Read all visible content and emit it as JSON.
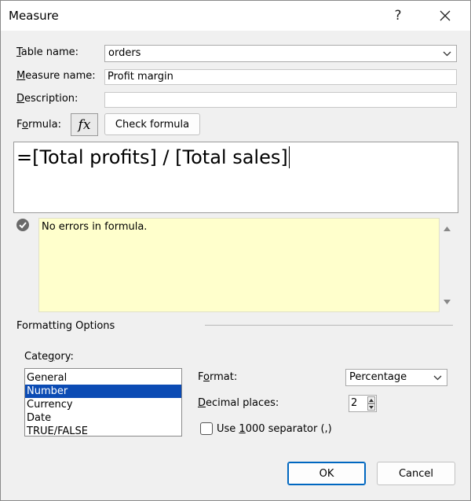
{
  "window": {
    "title": "Measure",
    "help_glyph": "?",
    "close_glyph": "✕"
  },
  "table_name": {
    "label_prefix": "",
    "label_accel": "T",
    "label_rest": "able name:",
    "value": "orders"
  },
  "measure_name": {
    "label_accel": "M",
    "label_rest": "easure name:",
    "value": "Profit margin"
  },
  "description": {
    "label_accel": "D",
    "label_rest": "escription:",
    "value": ""
  },
  "formula": {
    "label_pre": "F",
    "label_accel": "o",
    "label_rest": "rmula:",
    "fx_label": "fx",
    "check_button": "Check formula",
    "text": "=[Total profits] / [Total sales]"
  },
  "status": {
    "message": "No errors in formula."
  },
  "formatting": {
    "section_title": "Formatting Options",
    "category_label_pre": "Cate",
    "category_label_accel": "g",
    "category_label_rest": "ory:",
    "categories": [
      "General",
      "Number",
      "Currency",
      "Date",
      "TRUE/FALSE"
    ],
    "selected_category": "Number",
    "format_label_pre": "F",
    "format_label_accel": "o",
    "format_label_rest": "rmat:",
    "format_value": "Percentage",
    "decimal_label_pre": "",
    "decimal_label_accel": "D",
    "decimal_label_rest": "ecimal places:",
    "decimal_value": "2",
    "separator_pre": "Use ",
    "separator_accel": "1",
    "separator_rest": "000 separator (,)",
    "separator_checked": false
  },
  "buttons": {
    "ok": "OK",
    "cancel": "Cancel"
  },
  "colors": {
    "selection": "#0b4bb4",
    "status_bg": "#ffffcc",
    "default_border": "#0067c0"
  }
}
